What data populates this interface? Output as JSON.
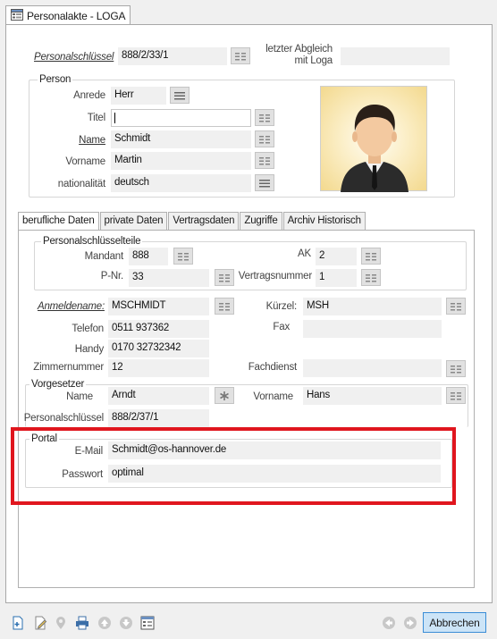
{
  "window_tab": {
    "label": "Personalakte - LOGA"
  },
  "header": {
    "personalschluessel_label": "Personalschlüssel",
    "personalschluessel_value": "888/2/33/1",
    "abgleich_label": "letzter Abgleich mit Loga",
    "abgleich_value": ""
  },
  "person": {
    "group_title": "Person",
    "anrede_label": "Anrede",
    "anrede_value": "Herr",
    "titel_label": "Titel",
    "titel_value": "",
    "name_label": "Name",
    "name_value": "Schmidt",
    "vorname_label": "Vorname",
    "vorname_value": "Martin",
    "nationalitaet_label": "nationalität",
    "nationalitaet_value": "deutsch"
  },
  "subtabs": [
    {
      "label": "berufliche Daten"
    },
    {
      "label": "private Daten"
    },
    {
      "label": "Vertragsdaten"
    },
    {
      "label": "Zugriffe"
    },
    {
      "label": "Archiv Historisch"
    }
  ],
  "personalschluesselteile": {
    "group_title": "Personalschlüsselteile",
    "mandant_label": "Mandant",
    "mandant_value": "888",
    "ak_label": "AK",
    "ak_value": "2",
    "pnr_label": "P-Nr.",
    "pnr_value": "33",
    "vertragsnummer_label": "Vertragsnummer",
    "vertragsnummer_value": "1"
  },
  "beruf": {
    "anmeldename_label": "Anmeldename:",
    "anmeldename_value": "MSCHMIDT",
    "kuerzel_label": "Kürzel:",
    "kuerzel_value": "MSH",
    "telefon_label": "Telefon",
    "telefon_value": "0511 937362",
    "fax_label": "Fax",
    "fax_value": "",
    "handy_label": "Handy",
    "handy_value": "0170 32732342",
    "zimmernummer_label": "Zimmernummer",
    "zimmernummer_value": "12",
    "fachdienst_label": "Fachdienst",
    "fachdienst_value": ""
  },
  "vorgesetzer": {
    "group_title": "Vorgesetzer",
    "name_label": "Name",
    "name_value": "Arndt",
    "vorname_label": "Vorname",
    "vorname_value": "Hans",
    "personalschluessel_label": "Personalschlüssel",
    "personalschluessel_value": "888/2/37/1"
  },
  "portal": {
    "group_title": "Portal",
    "email_label": "E-Mail",
    "email_value": "Schmidt@os-hannover.de",
    "passwort_label": "Passwort",
    "passwort_value": "optimal"
  },
  "footer": {
    "cancel_label": "Abbrechen"
  },
  "colors": {
    "highlight": "#e0161e",
    "cancel_bg": "#cce4f7",
    "cancel_border": "#3a8dd6"
  }
}
